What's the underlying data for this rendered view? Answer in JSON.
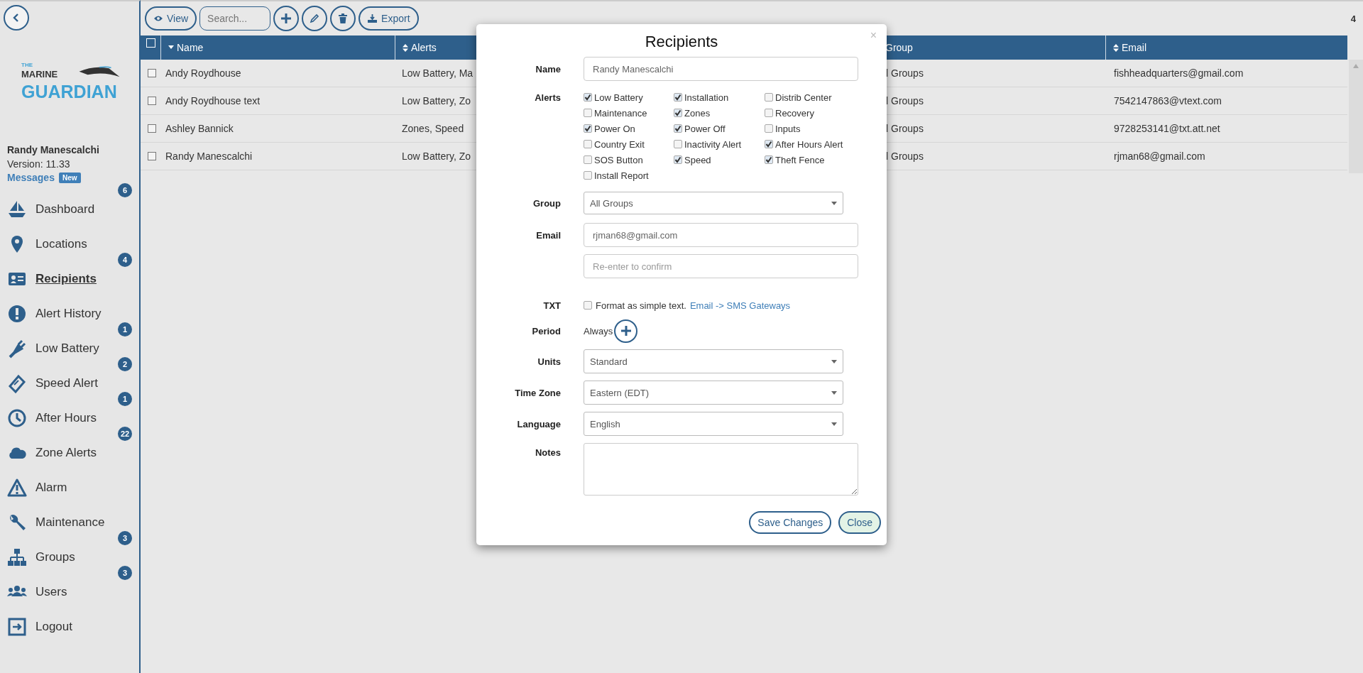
{
  "sidebar": {
    "logo": {
      "small": "THE",
      "top": "MARINE",
      "main": "GUARDIAN"
    },
    "user": "Randy Manescalchi",
    "version": "Version: 11.33",
    "messages": {
      "label": "Messages",
      "badge": "New"
    },
    "items": [
      {
        "label": "Dashboard",
        "kind": "boat",
        "selected": false,
        "badge": "6"
      },
      {
        "label": "Locations",
        "kind": "pin",
        "selected": false
      },
      {
        "label": "Recipients",
        "kind": "card",
        "selected": true,
        "badge": "4"
      },
      {
        "label": "Alert History",
        "kind": "exclaim",
        "selected": false
      },
      {
        "label": "Low Battery",
        "kind": "plug",
        "selected": false,
        "badge": "1"
      },
      {
        "label": "Speed Alert",
        "kind": "ticket",
        "selected": false,
        "badge": "2"
      },
      {
        "label": "After Hours",
        "kind": "clock",
        "selected": false,
        "badge": "1"
      },
      {
        "label": "Zone Alerts",
        "kind": "cloud",
        "selected": false,
        "badge": "22"
      },
      {
        "label": "Alarm",
        "kind": "warning",
        "selected": false
      },
      {
        "label": "Maintenance",
        "kind": "wrench",
        "selected": false
      },
      {
        "label": "Groups",
        "kind": "sitemap",
        "selected": false,
        "badge": "3"
      },
      {
        "label": "Users",
        "kind": "users",
        "selected": false,
        "badge": "3"
      },
      {
        "label": "Logout",
        "kind": "logout",
        "selected": false
      }
    ]
  },
  "toolbar": {
    "view": "View",
    "search_placeholder": "Search...",
    "export": "Export",
    "count": "4"
  },
  "table": {
    "header_checked": false,
    "columns": [
      {
        "label": "Name",
        "kind": "sorted"
      },
      {
        "label": "Alerts",
        "kind": "sortable"
      },
      {
        "label": "Group",
        "kind": "plain"
      },
      {
        "label": "Email",
        "kind": "sortable"
      }
    ],
    "rows": [
      {
        "checked": false,
        "cells": [
          "Andy Roydhouse",
          "Low Battery, Ma",
          "l Groups",
          "fishheadquarters@gmail.com"
        ]
      },
      {
        "checked": false,
        "cells": [
          "Andy Roydhouse text",
          "Low Battery, Zo",
          "l Groups",
          "7542147863@vtext.com"
        ]
      },
      {
        "checked": false,
        "cells": [
          "Ashley Bannick",
          "Zones, Speed",
          "l Groups",
          "9728253141@txt.att.net"
        ]
      },
      {
        "checked": false,
        "cells": [
          "Randy Manescalchi",
          "Low Battery, Zo",
          "l Groups",
          "rjman68@gmail.com"
        ]
      }
    ]
  },
  "dialog": {
    "title": "Recipients",
    "close": "×",
    "name": {
      "label": "Name",
      "value": "Randy Manescalchi"
    },
    "alerts_label": "Alerts",
    "alerts": [
      {
        "label": "Low Battery",
        "checked": true
      },
      {
        "label": "Installation",
        "checked": true
      },
      {
        "label": "Distrib Center",
        "checked": false
      },
      {
        "label": "Maintenance",
        "checked": false
      },
      {
        "label": "Zones",
        "checked": true
      },
      {
        "label": "Recovery",
        "checked": false
      },
      {
        "label": "Power On",
        "checked": true
      },
      {
        "label": "Power Off",
        "checked": true
      },
      {
        "label": "Inputs",
        "checked": false
      },
      {
        "label": "Country Exit",
        "checked": false
      },
      {
        "label": "Inactivity Alert",
        "checked": false
      },
      {
        "label": "After Hours Alert",
        "checked": true
      },
      {
        "label": "SOS Button",
        "checked": false
      },
      {
        "label": "Speed",
        "checked": true
      },
      {
        "label": "Theft Fence",
        "checked": true
      },
      {
        "label": "Install Report",
        "checked": false
      }
    ],
    "group": {
      "label": "Group",
      "value": "All Groups"
    },
    "email": {
      "label": "Email",
      "value": "rjman68@gmail.com",
      "confirm_placeholder": "Re-enter to confirm"
    },
    "txt": {
      "label": "TXT",
      "checked": false,
      "text": "Format as simple text.",
      "link": "Email -> SMS Gateways"
    },
    "period": {
      "label": "Period",
      "value": "Always"
    },
    "selects": [
      {
        "label": "Units",
        "value": "Standard"
      },
      {
        "label": "Time Zone",
        "value": "Eastern (EDT)"
      },
      {
        "label": "Language",
        "value": "English"
      }
    ],
    "notes": {
      "label": "Notes"
    },
    "buttons": [
      {
        "label": "Save Changes",
        "kind": "primary"
      },
      {
        "label": "Close",
        "kind": "close"
      }
    ]
  }
}
